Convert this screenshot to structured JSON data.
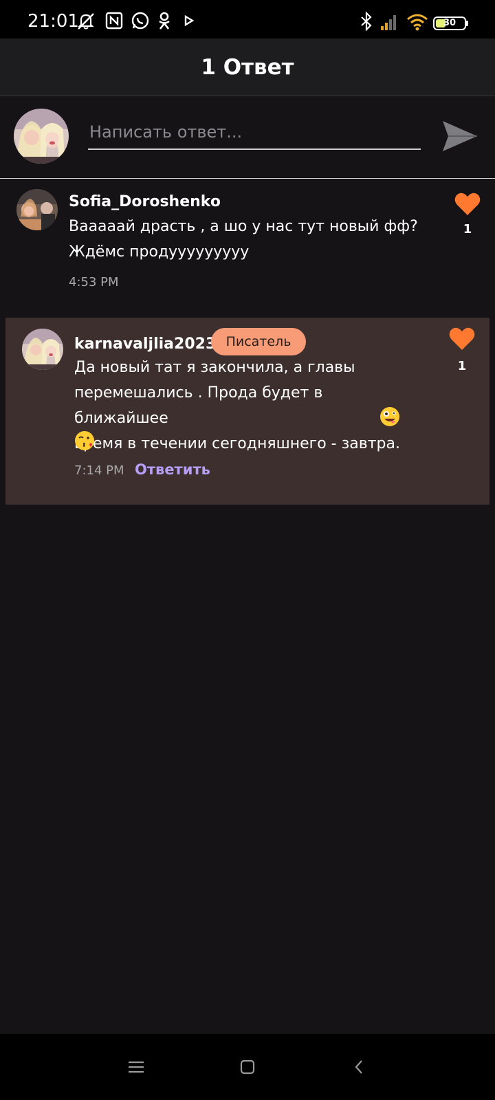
{
  "status_bar": {
    "time": "21:01",
    "battery_level": "30",
    "icons": [
      "notifications-muted-icon",
      "nfc-icon",
      "whatsapp-icon",
      "odnoklassniki-icon",
      "play-icon",
      "bluetooth-icon",
      "cell-signal-icon",
      "wifi-icon",
      "battery-icon"
    ],
    "colors": {
      "signal": "#e0a030",
      "wifi": "#f0b030",
      "battery_fill": "#e4f27a"
    }
  },
  "header": {
    "title": "1 Ответ"
  },
  "composer": {
    "placeholder": "Написать ответ...",
    "send_icon": "send-icon"
  },
  "comments": [
    {
      "username": "Sofia_Doroshenko",
      "text_lines": [
        "Вааааай драсть , а шо у нас тут новый фф?",
        "Ждёмс продууууууууу"
      ],
      "time": "4:53 PM",
      "likes": "1"
    },
    {
      "username": "karnavaljlia2023",
      "badge": "Писатель",
      "text_lines": [
        "Да новый тат я закончила, а главы",
        "перемешались . Прода будет в ближайшее",
        "время в течении сегодняшнего - завтра."
      ],
      "emojis": [
        "zany-face-emoji",
        "kissing-face-emoji"
      ],
      "time": "7:14 PM",
      "reply_label": "Ответить",
      "likes": "1"
    }
  ],
  "colors": {
    "background": "#151316",
    "header": "#1d1c1f",
    "highlight_comment": "#3d2f2e",
    "heart": "#ff7a30",
    "badge": "#f89c78",
    "reply_link": "#b79ef5"
  },
  "nav_bar": {
    "icons": [
      "menu-icon",
      "home-icon",
      "back-icon"
    ]
  }
}
